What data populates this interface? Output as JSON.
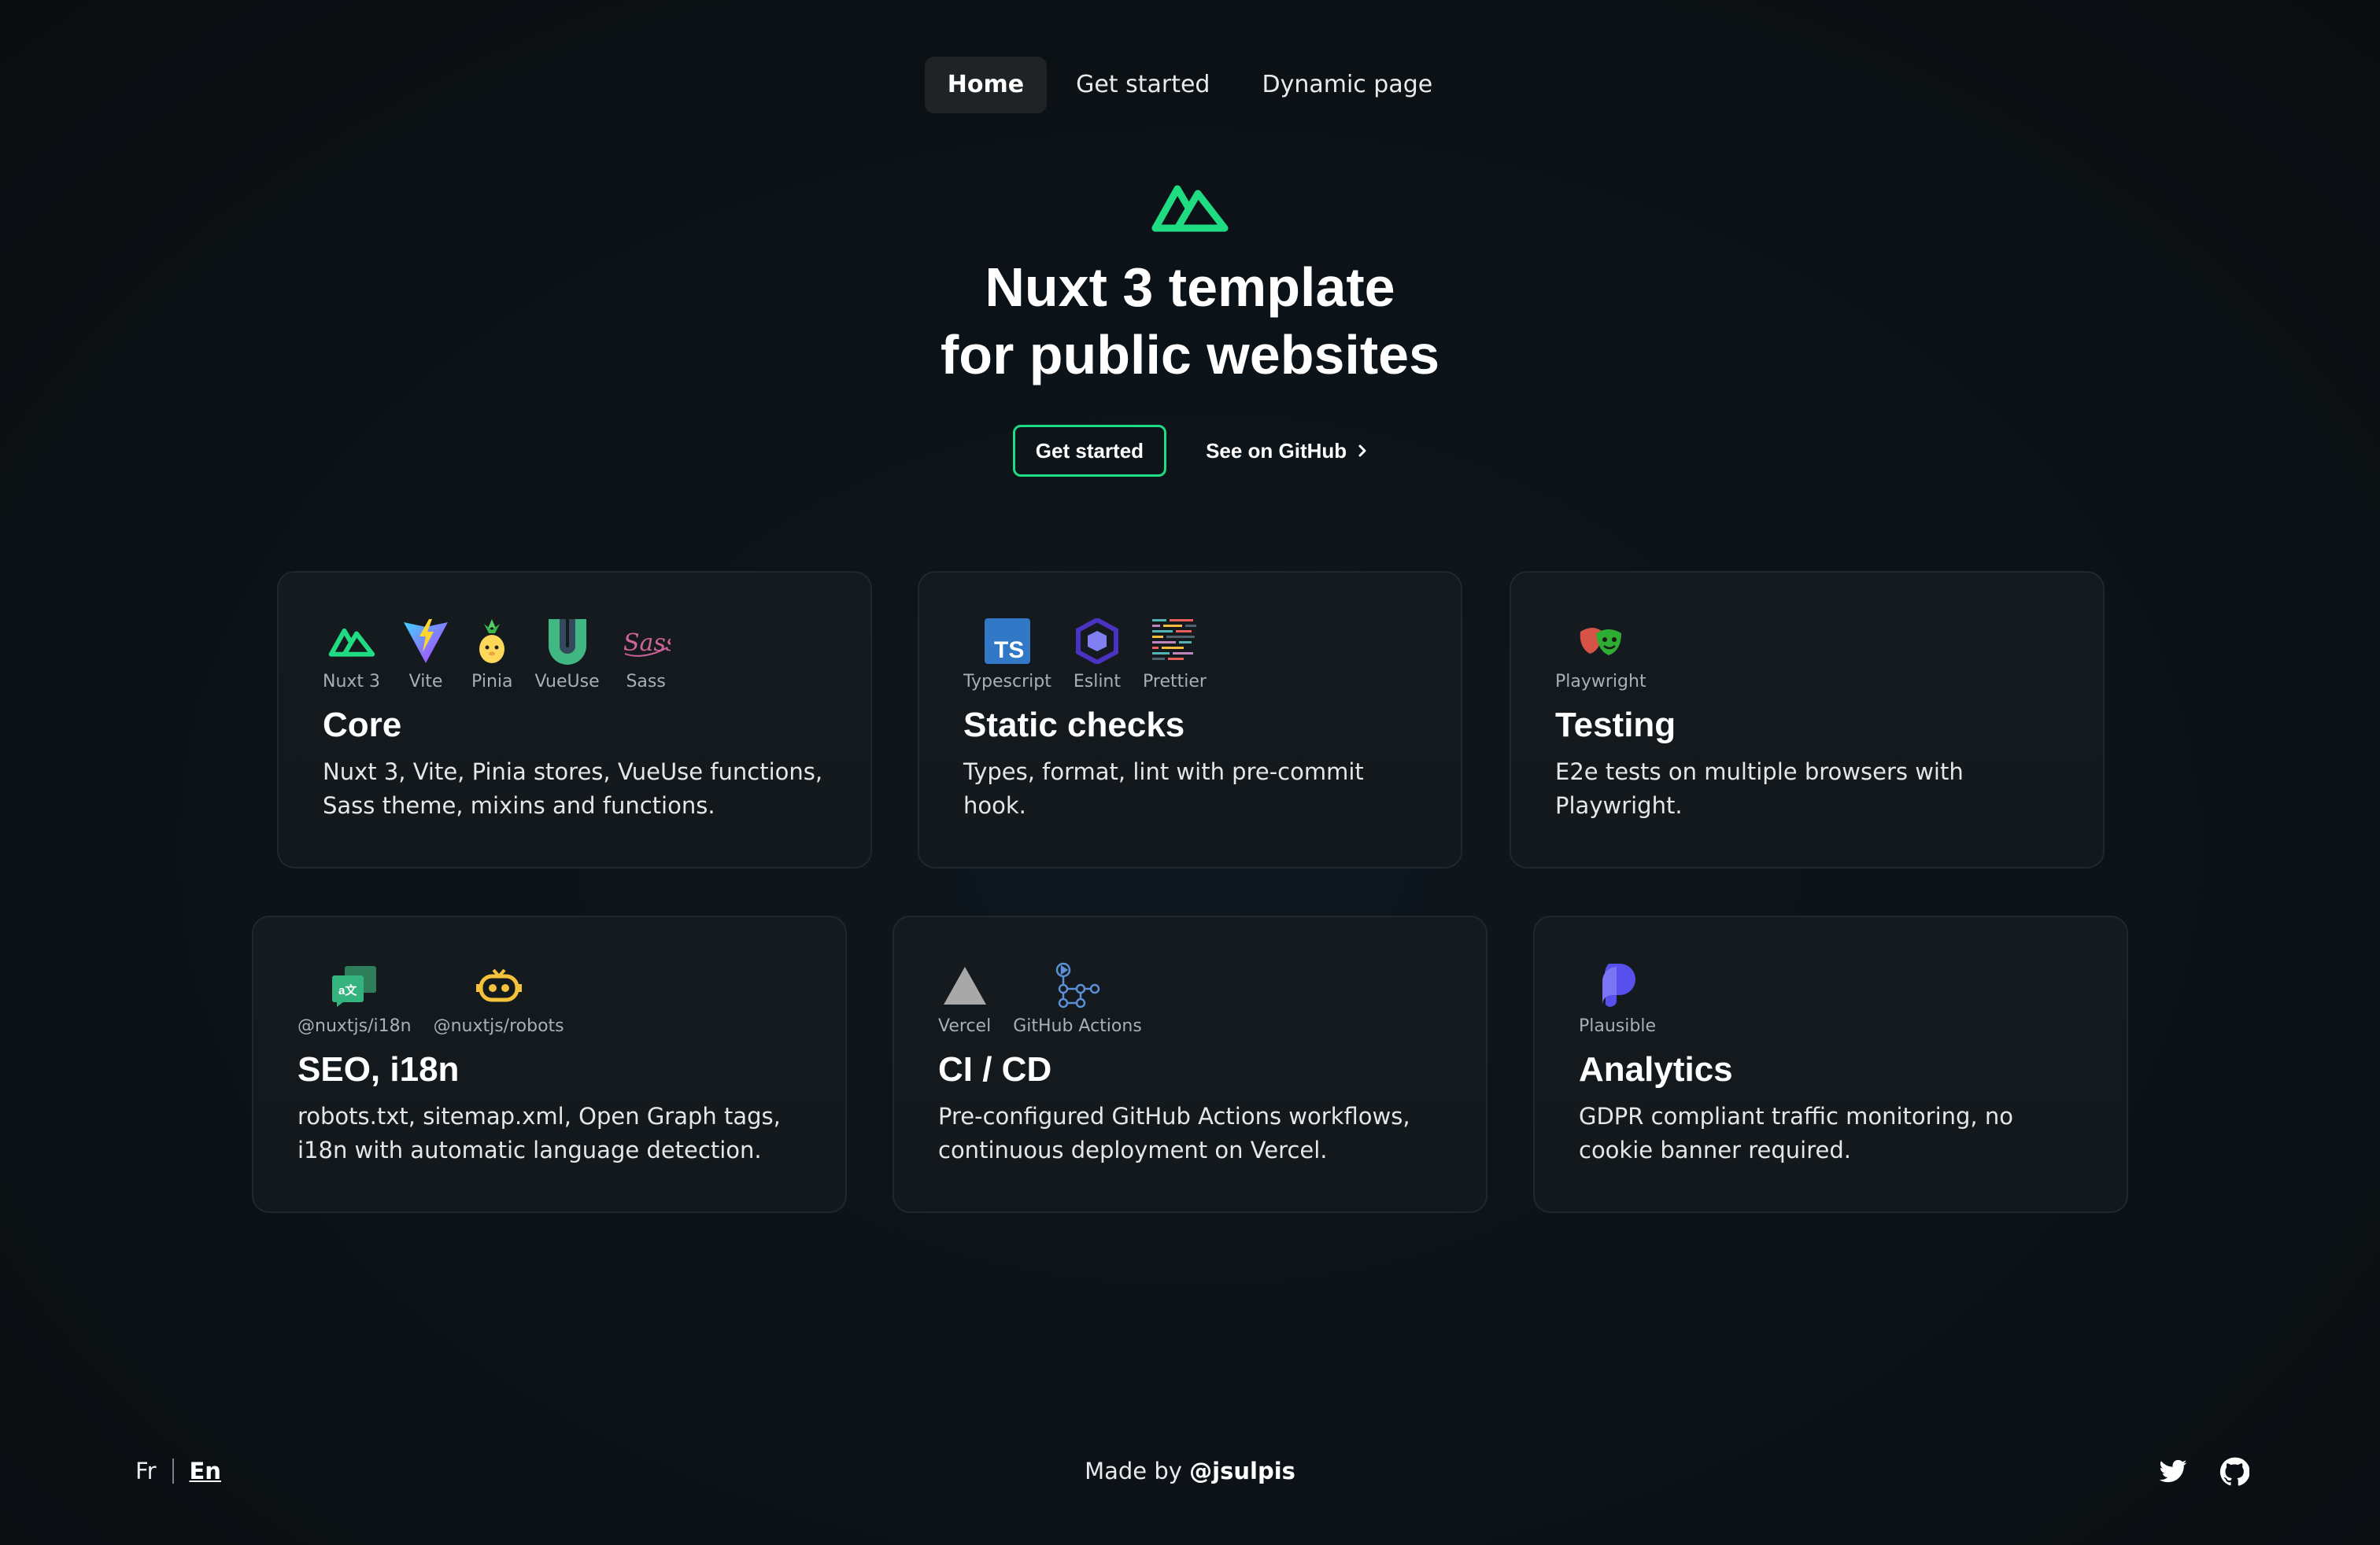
{
  "nav": {
    "items": [
      {
        "label": "Home",
        "active": true
      },
      {
        "label": "Get started",
        "active": false
      },
      {
        "label": "Dynamic page",
        "active": false
      }
    ]
  },
  "hero": {
    "logo_icon": "nuxt-logo-icon",
    "title_line1": "Nuxt 3 template",
    "title_line2": "for public websites",
    "primary_button": "Get started",
    "secondary_button": "See on GitHub",
    "accent_color": "#1fdc82"
  },
  "cards": [
    {
      "title": "Core",
      "description": "Nuxt 3, Vite, Pinia stores, VueUse functions, Sass theme, mixins and functions.",
      "techs": [
        {
          "label": "Nuxt 3",
          "icon": "nuxt-icon"
        },
        {
          "label": "Vite",
          "icon": "vite-icon"
        },
        {
          "label": "Pinia",
          "icon": "pinia-icon"
        },
        {
          "label": "VueUse",
          "icon": "vueuse-icon"
        },
        {
          "label": "Sass",
          "icon": "sass-icon"
        }
      ]
    },
    {
      "title": "Static checks",
      "description": "Types, format, lint with pre-commit hook.",
      "techs": [
        {
          "label": "Typescript",
          "icon": "typescript-icon"
        },
        {
          "label": "Eslint",
          "icon": "eslint-icon"
        },
        {
          "label": "Prettier",
          "icon": "prettier-icon"
        }
      ]
    },
    {
      "title": "Testing",
      "description": "E2e tests on multiple browsers with Playwright.",
      "techs": [
        {
          "label": "Playwright",
          "icon": "playwright-icon"
        }
      ]
    },
    {
      "title": "SEO, i18n",
      "description": "robots.txt, sitemap.xml, Open Graph tags, i18n with automatic language detection.",
      "techs": [
        {
          "label": "@nuxtjs/i18n",
          "icon": "i18n-icon"
        },
        {
          "label": "@nuxtjs/robots",
          "icon": "robots-icon"
        }
      ]
    },
    {
      "title": "CI / CD",
      "description": "Pre-configured GitHub Actions workflows, continuous deployment on Vercel.",
      "techs": [
        {
          "label": "Vercel",
          "icon": "vercel-icon"
        },
        {
          "label": "GitHub Actions",
          "icon": "github-actions-icon"
        }
      ]
    },
    {
      "title": "Analytics",
      "description": "GDPR compliant traffic monitoring, no cookie banner required.",
      "techs": [
        {
          "label": "Plausible",
          "icon": "plausible-icon"
        }
      ]
    }
  ],
  "footer": {
    "languages": [
      {
        "label": "Fr",
        "active": false
      },
      {
        "label": "En",
        "active": true
      }
    ],
    "made_by_prefix": "Made by",
    "made_by_handle": "@jsulpis",
    "social": [
      "twitter-icon",
      "github-icon"
    ]
  }
}
